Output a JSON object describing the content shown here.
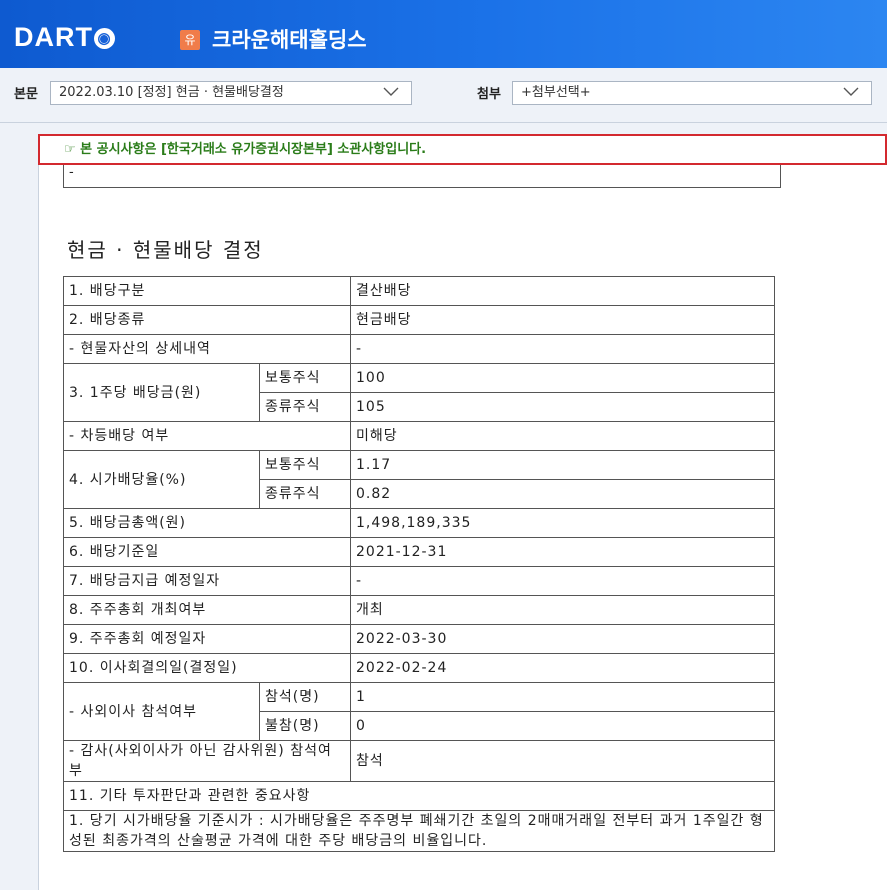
{
  "header": {
    "logo_text": "DART",
    "logo_badge": "◉",
    "market_badge": "유",
    "company": "크라운해태홀딩스"
  },
  "toolbar": {
    "main_label": "본문",
    "main_select": "2022.03.10  [정정] 현금 · 현물배당결정",
    "attach_label": "첨부",
    "attach_select": "+첨부선택+"
  },
  "notice": "☞ 본 공시사항은 [한국거래소 유가증권시장본부] 소관사항입니다.",
  "prev_cell": "-",
  "doc_title": "현금 · 현물배당 결정",
  "rows": {
    "r1": {
      "label": "1. 배당구분",
      "value": "결산배당"
    },
    "r2": {
      "label": "2. 배당종류",
      "value": "현금배당"
    },
    "r3": {
      "label": "- 현물자산의 상세내역",
      "value": "-"
    },
    "r4": {
      "label": "3. 1주당 배당금(원)",
      "sub1": "보통주식",
      "val1": "100",
      "sub2": "종류주식",
      "val2": "105"
    },
    "r5": {
      "label": "- 차등배당 여부",
      "value": "미해당"
    },
    "r6": {
      "label": "4. 시가배당율(%)",
      "sub1": "보통주식",
      "val1": "1.17",
      "sub2": "종류주식",
      "val2": "0.82"
    },
    "r7": {
      "label": "5. 배당금총액(원)",
      "value": "1,498,189,335"
    },
    "r8": {
      "label": "6. 배당기준일",
      "value": "2021-12-31"
    },
    "r9": {
      "label": "7. 배당금지급 예정일자",
      "value": "-"
    },
    "r10": {
      "label": "8. 주주총회 개최여부",
      "value": "개최"
    },
    "r11": {
      "label": "9. 주주총회 예정일자",
      "value": "2022-03-30"
    },
    "r12": {
      "label": "10. 이사회결의일(결정일)",
      "value": "2022-02-24"
    },
    "r13": {
      "label": "- 사외이사 참석여부",
      "sub1": "참석(명)",
      "val1": "1",
      "sub2": "불참(명)",
      "val2": "0"
    },
    "r14": {
      "label": "- 감사(사외이사가 아닌 감사위원) 참석여부",
      "value": "참석"
    },
    "r15": {
      "label": "11. 기타 투자판단과 관련한 중요사항"
    },
    "r16": {
      "text": "1. 당기 시가배당율 기준시가 : 시가배당율은 주주명부 폐쇄기간 초일의 2매매거래일 전부터 과거 1주일간 형성된 최종가격의 산술평균 가격에 대한 주당 배당금의 비율입니다."
    }
  },
  "colors": {
    "header_blue": "#1b72e8",
    "notice_border": "#d3292f",
    "notice_text": "#2a7c19",
    "market_badge": "#f07c4a"
  }
}
